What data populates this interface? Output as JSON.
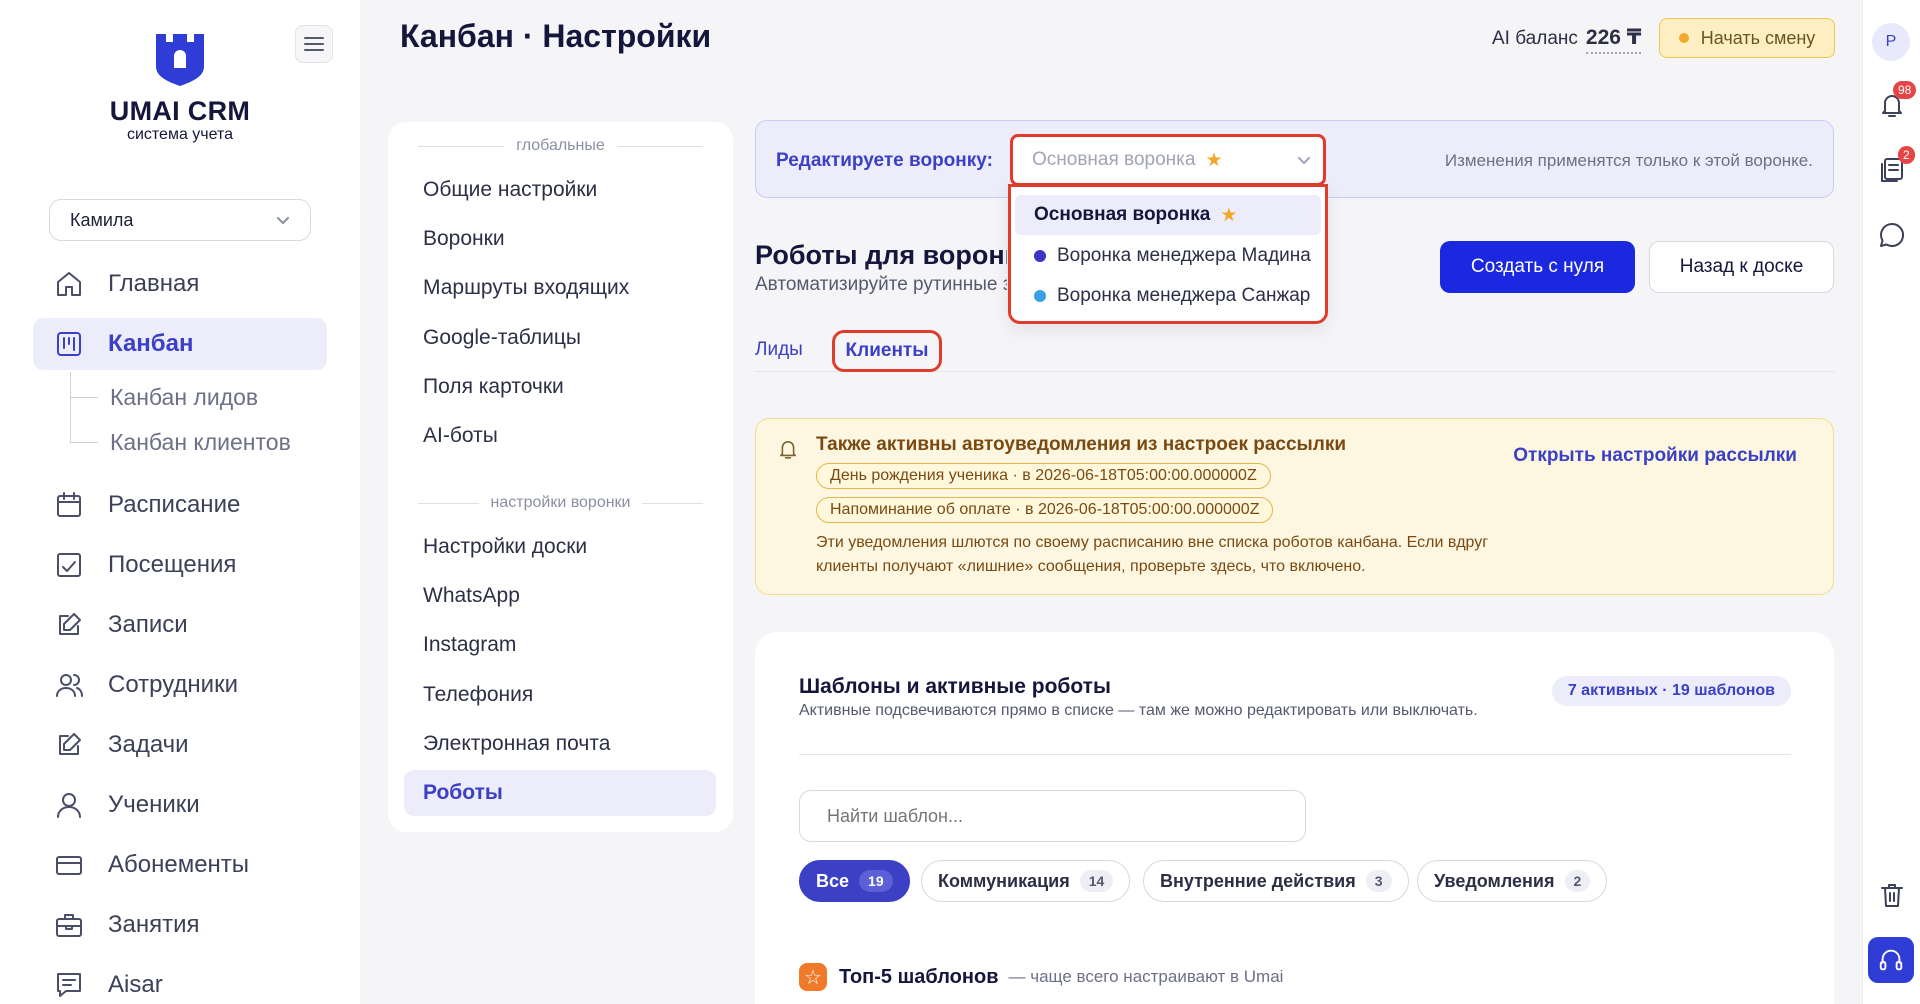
{
  "app": {
    "name": "UMAI CRM",
    "subtitle": "система учета"
  },
  "user_select": {
    "value": "Камила"
  },
  "nav": [
    {
      "label": "Главная",
      "icon": "home-icon"
    },
    {
      "label": "Канбан",
      "icon": "kanban-icon",
      "active": true
    },
    {
      "label": "Расписание",
      "icon": "calendar-icon"
    },
    {
      "label": "Посещения",
      "icon": "attendance-icon"
    },
    {
      "label": "Записи",
      "icon": "edit-icon"
    },
    {
      "label": "Сотрудники",
      "icon": "users-icon"
    },
    {
      "label": "Задачи",
      "icon": "edit-icon"
    },
    {
      "label": "Ученики",
      "icon": "user-icon"
    },
    {
      "label": "Абонементы",
      "icon": "card-icon"
    },
    {
      "label": "Занятия",
      "icon": "briefcase-icon"
    },
    {
      "label": "Aisar",
      "icon": "chat-icon"
    }
  ],
  "subnav": [
    "Канбан лидов",
    "Канбан клиентов"
  ],
  "header": {
    "title": "Канбан · Настройки",
    "ai_balance_label": "AI баланс",
    "ai_balance_value": "226 ₸",
    "start_shift": "Начать смену"
  },
  "rail": {
    "avatar": "P",
    "notifications_badge": "98",
    "docs_badge": "2"
  },
  "settings_menu": {
    "global_label": "глобальные",
    "global_items": [
      "Общие настройки",
      "Воронки",
      "Маршруты входящих",
      "Google-таблицы",
      "Поля карточки",
      "AI-боты"
    ],
    "funnel_label": "настройки воронки",
    "funnel_items": [
      "Настройки доски",
      "WhatsApp",
      "Instagram",
      "Телефония",
      "Электронная почта",
      "Роботы"
    ],
    "active": "Роботы"
  },
  "funnel": {
    "label": "Редактируете воронку:",
    "selected": "Основная воронка",
    "note": "Изменения применятся только к этой воронке.",
    "options": [
      {
        "label": "Основная воронка",
        "star": true
      },
      {
        "label": "Воронка менеджера Мадина",
        "dot_color": "#3b34c4"
      },
      {
        "label": "Воронка менеджера Санжар",
        "dot_color": "#3aa0e8"
      }
    ]
  },
  "robots": {
    "title": "Роботы для воронки",
    "subtitle": "Автоматизируйте рутинные задачи",
    "create_button": "Создать с нуля",
    "back_button": "Назад к доске"
  },
  "tabs": {
    "leads": "Лиды",
    "clients": "Клиенты"
  },
  "notice": {
    "title": "Также активны автоуведомления из настроек рассылки",
    "chips": [
      "День рождения ученика · в 2026-06-18T05:00:00.000000Z",
      "Напоминание об оплате · в 2026-06-18T05:00:00.000000Z"
    ],
    "text": "Эти уведомления шлются по своему расписанию вне списка роботов канбана. Если вдруг клиенты получают «лишние» сообщения, проверьте здесь, что включено.",
    "link": "Открыть настройки рассылки"
  },
  "templates": {
    "title": "Шаблоны и активные роботы",
    "subtitle": "Активные подсвечиваются прямо в списке — там же можно редактировать или выключать.",
    "badge": "7 активных · 19 шаблонов",
    "search_placeholder": "Найти шаблон...",
    "filters": [
      {
        "label": "Все",
        "count": "19",
        "active": true
      },
      {
        "label": "Коммуникация",
        "count": "14"
      },
      {
        "label": "Внутренние действия",
        "count": "3"
      },
      {
        "label": "Уведомления",
        "count": "2"
      }
    ],
    "top5_title": "Топ-5 шаблонов",
    "top5_sub": "— чаще всего настраивают в Umai"
  }
}
